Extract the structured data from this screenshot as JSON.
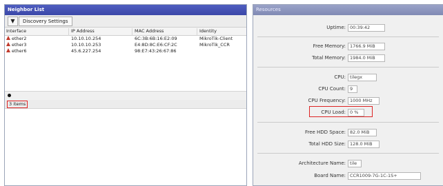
{
  "neighbor_window": {
    "title": "Neighbor List",
    "filter_icon": "filter-icon",
    "discovery_button": "Discovery Settings",
    "columns": [
      "Interface",
      "IP Address",
      "MAC Address",
      "Identity"
    ],
    "rows": [
      {
        "interface": "ether2",
        "ip": "10.10.10.254",
        "mac": "6C:3B:6B:16:E2:09",
        "identity": "MikroTik-Client"
      },
      {
        "interface": "ether3",
        "ip": "10.10.10.253",
        "mac": "E4:8D:8C:E6:CF:2C",
        "identity": "MikroTik_CCR"
      },
      {
        "interface": "ether6",
        "ip": "45.6.227.254",
        "mac": "98:E7:43:26:67:86",
        "identity": ""
      }
    ],
    "status_items": "3 items"
  },
  "resources_window": {
    "title": "Resources",
    "uptime_label": "Uptime:",
    "uptime": "00:39:42",
    "free_memory_label": "Free Memory:",
    "free_memory": "1766.9 MiB",
    "total_memory_label": "Total Memory:",
    "total_memory": "1984.0 MiB",
    "cpu_label": "CPU:",
    "cpu": "tilegx",
    "cpu_count_label": "CPU Count:",
    "cpu_count": "9",
    "cpu_freq_label": "CPU Frequency:",
    "cpu_freq": "1000 MHz",
    "cpu_load_label": "CPU Load:",
    "cpu_load": "0 %",
    "free_hdd_label": "Free HDD Space:",
    "free_hdd": "82.0 MiB",
    "total_hdd_label": "Total HDD Size:",
    "total_hdd": "128.0 MiB",
    "arch_label": "Architecture Name:",
    "arch": "tile",
    "board_label": "Board Name:",
    "board": "CCR1009-7G-1C-1S+"
  },
  "highlight_color": "#dd2222"
}
